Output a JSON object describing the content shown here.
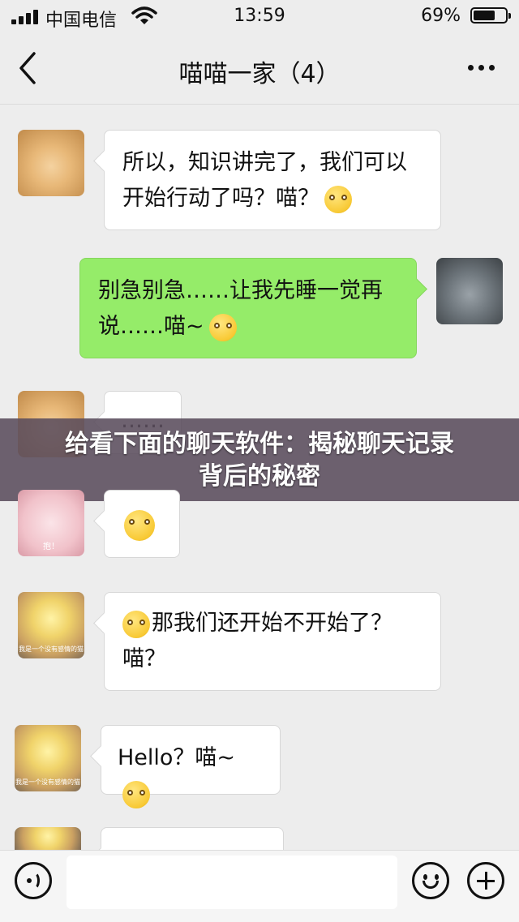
{
  "status_bar": {
    "carrier": "中国电信",
    "time": "13:59",
    "battery_percent": "69%",
    "battery_level": 0.69,
    "icons": [
      "signal-icon",
      "wifi-icon",
      "battery-icon"
    ]
  },
  "nav": {
    "title": "喵喵一家（4）",
    "back_icon": "chevron-left-icon",
    "more_icon": "more-icon"
  },
  "messages": [
    {
      "side": "left",
      "avatar": "orange-cat",
      "line1": "所以，知识讲完了，我们可以",
      "line2": "开始行动了吗？喵？"
    },
    {
      "side": "right",
      "avatar": "grey-cat",
      "line1": "别急别急……让我先睡一觉再",
      "line2": "说……喵~"
    },
    {
      "side": "left",
      "avatar": "orange-cat",
      "text": "……"
    },
    {
      "side": "left",
      "avatar": "pink-cat",
      "avatar_caption": "抱！",
      "text": ""
    },
    {
      "side": "left",
      "avatar": "hat-cat",
      "avatar_caption": "我是一个没有感情的猫",
      "line1": "那我们还开始不开始了？",
      "line2": "喵？"
    },
    {
      "side": "left",
      "avatar": "hat-cat",
      "avatar_caption": "我是一个没有感情的猫",
      "text": "Hello？喵~"
    },
    {
      "side": "left",
      "avatar": "hat-cat",
      "text": ""
    }
  ],
  "banner": {
    "line1": "给看下面的聊天软件：揭秘聊天记录",
    "line2": "背后的秘密"
  },
  "input_bar": {
    "voice_icon": "voice-icon",
    "emoji_icon": "emoji-icon",
    "plus_icon": "plus-icon"
  }
}
